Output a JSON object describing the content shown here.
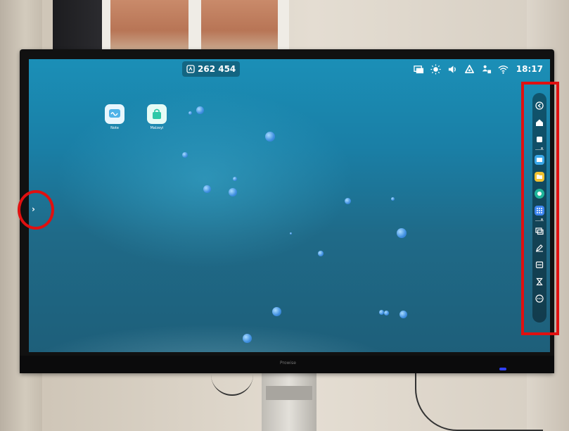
{
  "screen": {
    "room_code": "262 454",
    "status": {
      "time": "18:17",
      "icons": [
        "screen-share-icon",
        "brightness-icon",
        "volume-icon",
        "cloud-icon",
        "user-network-icon",
        "wifi-icon"
      ]
    },
    "desktop_icons": [
      {
        "label": "Note",
        "icon": "whiteboard-icon",
        "color": "#4fb3e8"
      },
      {
        "label": "Malzeyi",
        "icon": "android-bag-icon",
        "color": "#2fc8a8"
      }
    ],
    "side_handle": "›",
    "dock": {
      "items": [
        {
          "name": "back-icon"
        },
        {
          "name": "home-icon"
        },
        {
          "name": "recent-apps-icon"
        },
        {
          "name": "separator"
        },
        {
          "name": "note-app-icon",
          "color": "#3aa8e8"
        },
        {
          "name": "folder-app-icon",
          "color": "#f2c230"
        },
        {
          "name": "browser-app-icon",
          "color": "#20b59a"
        },
        {
          "name": "apps-grid-icon",
          "color": "#3d86f0"
        },
        {
          "name": "separator"
        },
        {
          "name": "screen-share-icon"
        },
        {
          "name": "annotate-icon"
        },
        {
          "name": "screenshot-icon"
        },
        {
          "name": "timer-icon"
        },
        {
          "name": "more-icon"
        }
      ]
    }
  },
  "monitor": {
    "brand": "Prowise"
  },
  "annotations": {
    "color": "#e01010"
  }
}
